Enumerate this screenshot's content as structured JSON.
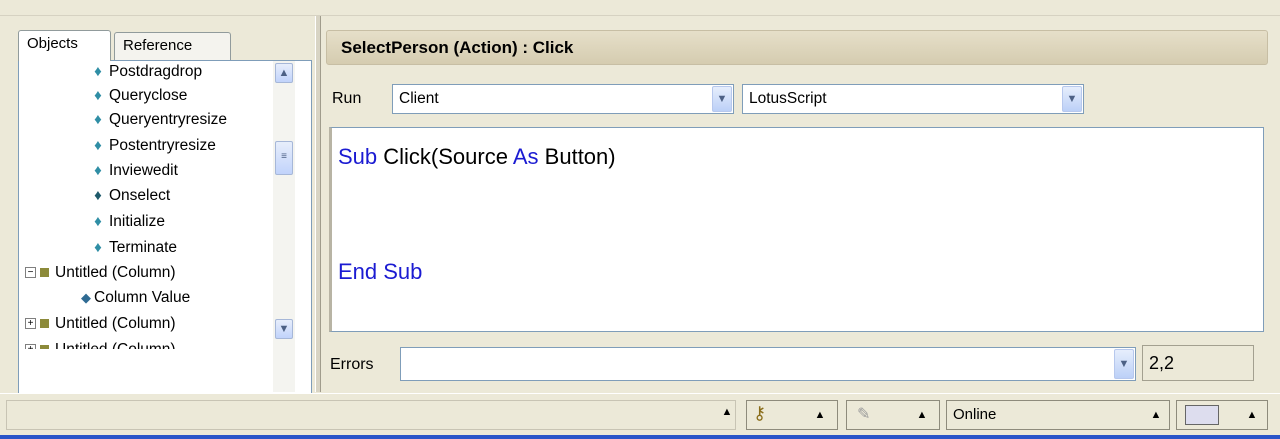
{
  "left_panel": {
    "tabs": [
      {
        "label": "Objects",
        "active": true
      },
      {
        "label": "Reference",
        "active": false
      }
    ],
    "tree": [
      {
        "label": "Postdragdrop",
        "kind": "event"
      },
      {
        "label": "Queryclose",
        "kind": "event"
      },
      {
        "label": "Queryentryresize",
        "kind": "event"
      },
      {
        "label": "Postentryresize",
        "kind": "event"
      },
      {
        "label": "Inviewedit",
        "kind": "event"
      },
      {
        "label": "Onselect",
        "kind": "event-filled"
      },
      {
        "label": "Initialize",
        "kind": "event"
      },
      {
        "label": "Terminate",
        "kind": "event"
      },
      {
        "label": "Untitled (Column)",
        "kind": "column",
        "expander": "−"
      },
      {
        "label": "Column Value",
        "kind": "value"
      },
      {
        "label": "Untitled (Column)",
        "kind": "column",
        "expander": "+"
      },
      {
        "label": "Untitled (Column)",
        "kind": "column",
        "expander": "+"
      }
    ]
  },
  "editor_pane": {
    "title": "SelectPerson (Action) : Click",
    "run_label": "Run",
    "run_target": "Client",
    "language": "LotusScript",
    "code": {
      "line1": {
        "kw1": "Sub",
        "text1": " Click(Source ",
        "kw2": "As",
        "text2": " Button)"
      },
      "line2": {
        "kw": "End Sub"
      }
    },
    "errors_label": "Errors",
    "errors_value": "",
    "cursor_position": "2,2"
  },
  "status_bar": {
    "connection": "Online"
  },
  "icons": {
    "event": "event-icon",
    "column": "column-icon",
    "scroll_up": "chevron-up-icon",
    "scroll_down": "chevron-down-icon",
    "dropdown": "chevron-down-icon",
    "status_key": "key-icon",
    "status_tools": "tools-icon",
    "status_inbox": "inbox-icon"
  },
  "colors": {
    "keyword": "#1b1bd2",
    "event_icon": "#2f8ea5",
    "column_icon": "#8c8a3a",
    "chrome": "#ece9d8"
  }
}
